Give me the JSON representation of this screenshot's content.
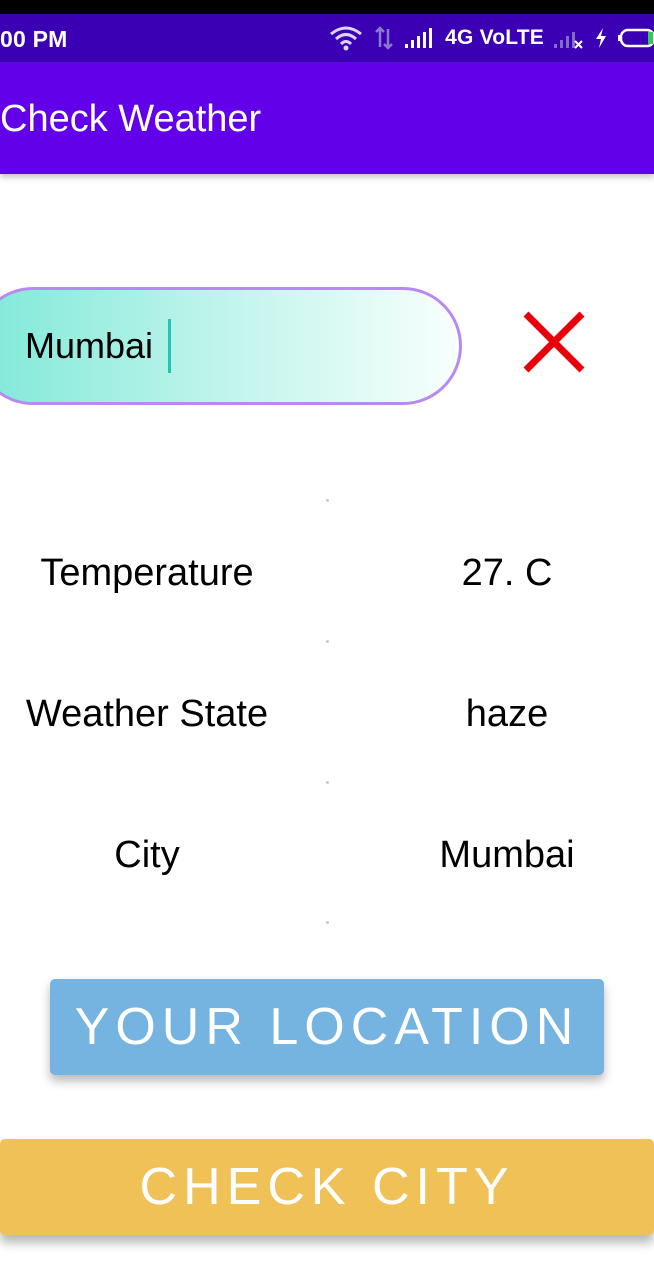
{
  "status_bar": {
    "time": "00 PM",
    "network": "4G VoLTE",
    "icons": [
      "wifi-icon",
      "data-arrows-icon",
      "signal-icon",
      "no-signal-icon",
      "charging-icon",
      "battery-icon"
    ]
  },
  "app_bar": {
    "title": "Check Weather"
  },
  "search": {
    "value": "Mumbai",
    "clear_icon": "close-icon"
  },
  "weather": {
    "rows": [
      {
        "label": "Temperature",
        "value": "27. C"
      },
      {
        "label": "Weather State",
        "value": "haze"
      },
      {
        "label": "City",
        "value": "Mumbai"
      }
    ]
  },
  "buttons": {
    "your_location": "YOUR LOCATION",
    "check_city": "CHECK CITY"
  },
  "colors": {
    "status_bar": "#3b00b3",
    "app_bar": "#6200ea",
    "clear_icon": "#e8000b",
    "location_button": "#75b3e0",
    "check_city_button": "#f0c156",
    "field_border": "#b889f0"
  }
}
